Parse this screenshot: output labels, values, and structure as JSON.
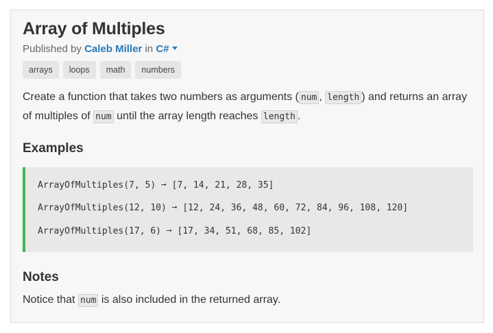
{
  "challenge": {
    "title": "Array of Multiples",
    "published_prefix": "Published by",
    "author": "Caleb Miller",
    "in_text": "in",
    "language": "C#",
    "tags": [
      "arrays",
      "loops",
      "math",
      "numbers"
    ]
  },
  "description": {
    "part1": "Create a function that takes two numbers as arguments (",
    "code1": "num",
    "sep": ", ",
    "code2": "length",
    "part2": ") and returns an array of multiples of ",
    "code3": "num",
    "part3": " until the array length reaches ",
    "code4": "length",
    "part4": "."
  },
  "examples": {
    "heading": "Examples",
    "lines": [
      "ArrayOfMultiples(7, 5) ➞ [7, 14, 21, 28, 35]",
      "ArrayOfMultiples(12, 10) ➞ [12, 24, 36, 48, 60, 72, 84, 96, 108, 120]",
      "ArrayOfMultiples(17, 6) ➞ [17, 34, 51, 68, 85, 102]"
    ]
  },
  "notes": {
    "heading": "Notes",
    "part1": "Notice that ",
    "code": "num",
    "part2": " is also included in the returned array."
  },
  "colors": {
    "link": "#2a7ab8",
    "example_accent": "#3fb950"
  }
}
